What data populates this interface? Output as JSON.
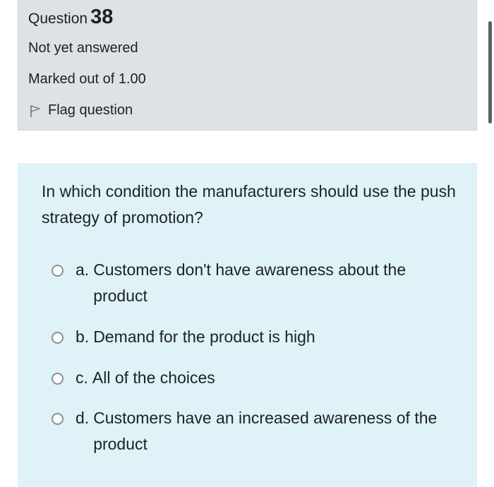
{
  "question_info": {
    "title_prefix": "Question",
    "number": "38",
    "state": "Not yet answered",
    "grade": "Marked out of 1.00",
    "flag_label": "Flag question",
    "flag_icon": "flag-outline-icon"
  },
  "question": {
    "text": "In which condition the manufacturers should use the push strategy of promotion?",
    "answers": [
      {
        "letter": "a.",
        "text": "Customers don't have awareness about the product",
        "selected": false
      },
      {
        "letter": "b.",
        "text": "Demand for the product is high",
        "selected": false
      },
      {
        "letter": "c.",
        "text": "All of the choices",
        "selected": false
      },
      {
        "letter": "d.",
        "text": "Customers have an increased awareness of the product",
        "selected": false
      }
    ]
  },
  "colors": {
    "info_background": "#dee2e6",
    "formulation_background": "#def2f8",
    "text": "#1d2125",
    "radio_border": "#8a8f95"
  }
}
